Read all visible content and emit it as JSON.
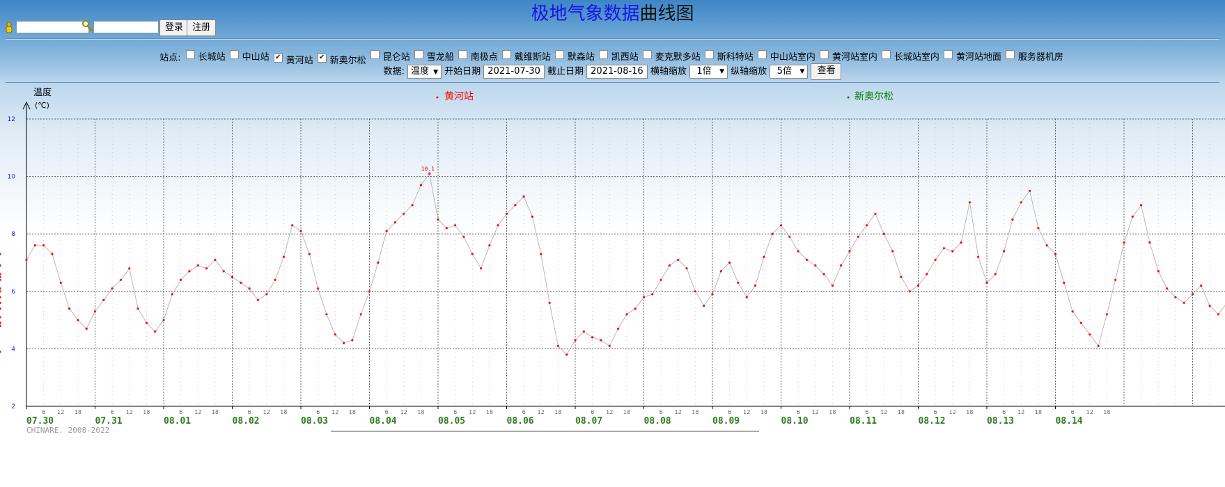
{
  "header": {
    "title_part1": "极地气象数据",
    "title_part2": "曲线图",
    "login_button": "登录",
    "register_button": "注册"
  },
  "stations": {
    "label": "站点:",
    "items": [
      {
        "name": "长城站",
        "checked": false
      },
      {
        "name": "中山站",
        "checked": false
      },
      {
        "name": "黄河站",
        "checked": true
      },
      {
        "name": "新奥尔松",
        "checked": true
      },
      {
        "name": "昆仑站",
        "checked": false
      },
      {
        "name": "雪龙船",
        "checked": false
      },
      {
        "name": "南极点",
        "checked": false
      },
      {
        "name": "戴维斯站",
        "checked": false
      },
      {
        "name": "默森站",
        "checked": false
      },
      {
        "name": "凯西站",
        "checked": false
      },
      {
        "name": "麦克默多站",
        "checked": false
      },
      {
        "name": "斯科特站",
        "checked": false
      },
      {
        "name": "中山站室内",
        "checked": false
      },
      {
        "name": "黄河站室内",
        "checked": false
      },
      {
        "name": "长城站室内",
        "checked": false
      },
      {
        "name": "黄河站地面",
        "checked": false
      },
      {
        "name": "服务器机房",
        "checked": false
      }
    ]
  },
  "controls": {
    "data_label": "数据:",
    "data_value": "温度",
    "start_label": "开始日期",
    "start_value": "2021-07-30",
    "end_label": "截止日期",
    "end_value": "2021-08-16",
    "xzoom_label": "横轴缩放",
    "xzoom_value": "1倍",
    "yzoom_label": "纵轴缩放",
    "yzoom_value": "5倍",
    "view_button": "查看"
  },
  "colors": {
    "series1": "#ff0000",
    "series2": "#008000",
    "line": "#b8b8b8",
    "date_label": "#2e7d1f",
    "ytick": "#1a1aff"
  },
  "chart_data": {
    "type": "line",
    "ylabel": "温度",
    "yunit": "(℃)",
    "ylim": [
      2,
      12
    ],
    "yticks": [
      2,
      4,
      6,
      8,
      10,
      12
    ],
    "grid": true,
    "legend_position": "top",
    "dates": [
      "07.30",
      "07.31",
      "08.01",
      "08.02",
      "08.03",
      "08.04",
      "08.05",
      "08.06",
      "08.07",
      "08.08",
      "08.09",
      "08.10",
      "08.11",
      "08.12",
      "08.13",
      "08.14"
    ],
    "hour_ticks": [
      "6",
      "12",
      "18"
    ],
    "annotation": "10.1",
    "series": [
      {
        "name": "黄河站",
        "hours_from_start": [
          0,
          3,
          6,
          9,
          12,
          15,
          18,
          21,
          24,
          27,
          30,
          33,
          36,
          39,
          42,
          45,
          48,
          51,
          54,
          57,
          60,
          63,
          66,
          69,
          72,
          75,
          78,
          81,
          84,
          87,
          90,
          93,
          96,
          99,
          102,
          105,
          108,
          111,
          114,
          117,
          120,
          123,
          126,
          129,
          132,
          135,
          138,
          141,
          144,
          147,
          150,
          153,
          156,
          159,
          162,
          165,
          168,
          171,
          174,
          177,
          180,
          183,
          186,
          189,
          192,
          195,
          198,
          201,
          204,
          207,
          210,
          213,
          216,
          219,
          222,
          225,
          228,
          231,
          234,
          237,
          240,
          243,
          246,
          249,
          252,
          255,
          258,
          261,
          264,
          267,
          270,
          273,
          276,
          279,
          282,
          285,
          288,
          291,
          294,
          297,
          300,
          303,
          306,
          309,
          312,
          315,
          318,
          321,
          324,
          327,
          330,
          333,
          336,
          339,
          342,
          345,
          348,
          351,
          354,
          357,
          360,
          363,
          366,
          369,
          372,
          375,
          378,
          381,
          384,
          387,
          390,
          393,
          396,
          399,
          402,
          405,
          408,
          411,
          414,
          417,
          420,
          423,
          426
        ],
        "values": [
          7.1,
          7.6,
          7.6,
          7.3,
          6.3,
          5.4,
          5.0,
          4.7,
          5.3,
          5.7,
          6.1,
          6.4,
          6.8,
          5.4,
          4.9,
          4.6,
          5.0,
          5.9,
          6.4,
          6.7,
          6.9,
          6.8,
          7.1,
          6.7,
          6.5,
          6.3,
          6.1,
          5.7,
          5.9,
          6.4,
          7.2,
          8.3,
          8.1,
          7.3,
          6.1,
          5.2,
          4.5,
          4.2,
          4.3,
          5.2,
          6.0,
          7.0,
          8.1,
          8.4,
          8.7,
          9.0,
          9.7,
          10.1,
          8.5,
          8.2,
          8.3,
          7.9,
          7.3,
          6.8,
          7.6,
          8.3,
          8.7,
          9.0,
          9.3,
          8.6,
          7.3,
          5.6,
          4.1,
          3.8,
          4.3,
          4.6,
          4.4,
          4.3,
          4.1,
          4.7,
          5.2,
          5.4,
          5.8,
          5.9,
          6.4,
          6.9,
          7.1,
          6.8,
          6.0,
          5.5,
          5.9,
          6.7,
          7.0,
          6.3,
          5.8,
          6.2,
          7.2,
          8.0,
          8.3,
          7.9,
          7.4,
          7.1,
          6.9,
          6.6,
          6.2,
          6.9,
          7.4,
          7.9,
          8.3,
          8.7,
          8.0,
          7.4,
          6.5,
          6.0,
          6.2,
          6.6,
          7.1,
          7.5,
          7.4,
          7.7,
          9.1,
          7.2,
          6.3,
          6.6,
          7.4,
          8.5,
          9.1,
          9.5,
          8.2,
          7.6,
          7.3,
          6.3,
          5.3,
          4.9,
          4.5,
          4.1,
          5.2,
          6.4,
          7.7,
          8.6,
          9.0,
          7.7,
          6.7,
          6.1,
          5.8,
          5.6,
          5.9,
          6.2,
          5.5,
          5.2,
          5.6,
          6.2,
          6.5,
          6.0,
          5.4,
          4.8,
          3.9,
          4.9,
          5.8,
          6.4,
          6.6,
          6.9,
          7.3,
          6.5,
          6.1,
          5.6,
          5.1,
          4.8,
          4.9,
          5.4,
          5.6
        ]
      },
      {
        "name": "新奥尔松",
        "values": []
      }
    ]
  },
  "footer": {
    "copyright": "CHINARE. 2008-2022"
  }
}
